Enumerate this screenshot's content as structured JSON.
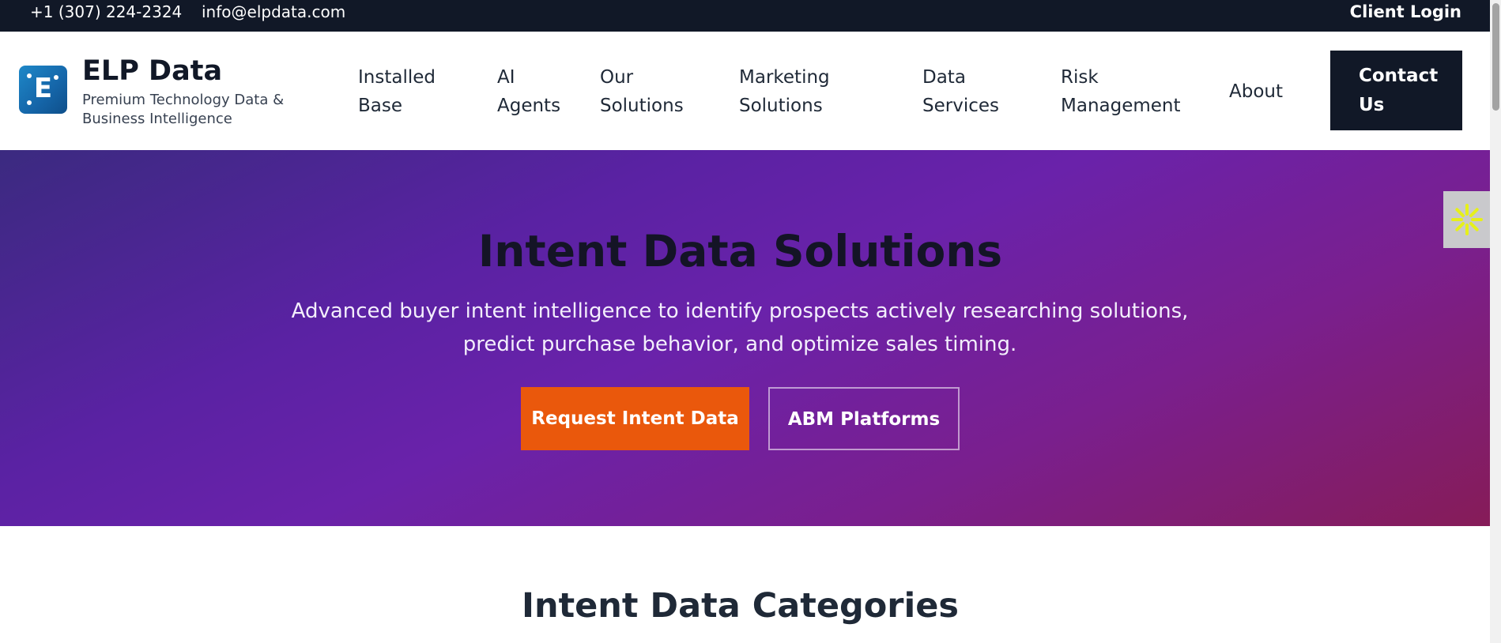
{
  "topbar": {
    "phone": "+1 (307) 224-2324",
    "email": "info@elpdata.com",
    "login": "Client Login"
  },
  "brand": {
    "logo_letter": "E",
    "name": "ELP Data",
    "tagline": "Premium Technology Data & Business Intelligence"
  },
  "nav": {
    "installed_base": "Installed Base",
    "ai_agents": "AI Agents",
    "our_solutions": "Our Solutions",
    "marketing_solutions": "Marketing Solutions",
    "data_services": "Data Services",
    "risk_management": "Risk Management",
    "about": "About",
    "contact": "Contact Us"
  },
  "hero": {
    "title": "Intent Data Solutions",
    "subtitle": "Advanced buyer intent intelligence to identify prospects actively researching solutions, predict purchase behavior, and optimize sales timing.",
    "primary_cta": "Request Intent Data",
    "secondary_cta": "ABM Platforms"
  },
  "section": {
    "title": "Intent Data Categories"
  },
  "icons": {
    "side_widget": "accessibility-asterisk-icon"
  },
  "colors": {
    "topbar_bg": "#111827",
    "accent_orange": "#ea580c",
    "hero_purple": "#6a22aa",
    "hero_red": "#861c58",
    "widget_yellow": "#e6f01a"
  }
}
